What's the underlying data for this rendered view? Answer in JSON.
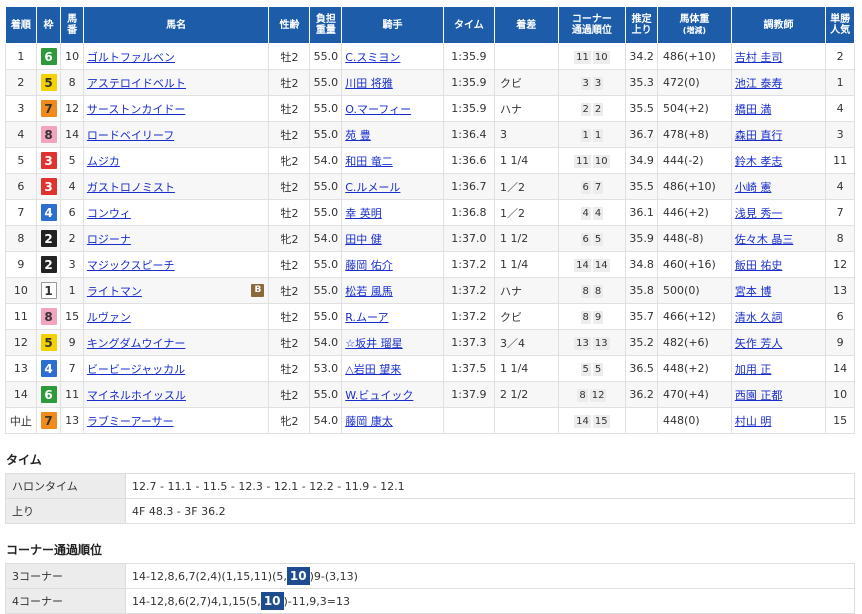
{
  "headers": {
    "rank": "着順",
    "waku": "枠",
    "umaban": [
      "馬",
      "番"
    ],
    "horse": "馬名",
    "sexage": "性齢",
    "weight": [
      "負担",
      "重量"
    ],
    "jockey": "騎手",
    "time": "タイム",
    "margin": "着差",
    "corner": [
      "コーナー",
      "通過順位"
    ],
    "last3f": [
      "推定",
      "上り"
    ],
    "hweight": [
      "馬体重",
      "(増減)"
    ],
    "trainer": "調教師",
    "pop": [
      "単勝",
      "人気"
    ]
  },
  "waku_colors": {
    "1": {
      "bg": "#ffffff",
      "fg": "#333333",
      "border": "#999999"
    },
    "2": {
      "bg": "#222222",
      "fg": "#ffffff",
      "border": "#222222"
    },
    "3": {
      "bg": "#e0332f",
      "fg": "#ffffff",
      "border": "#e0332f"
    },
    "4": {
      "bg": "#2d6fd0",
      "fg": "#ffffff",
      "border": "#2d6fd0"
    },
    "5": {
      "bg": "#f3d200",
      "fg": "#333333",
      "border": "#f3d200"
    },
    "6": {
      "bg": "#2f9a3b",
      "fg": "#ffffff",
      "border": "#2f9a3b"
    },
    "7": {
      "bg": "#f08a1c",
      "fg": "#333333",
      "border": "#f08a1c"
    },
    "8": {
      "bg": "#f2a4bd",
      "fg": "#333333",
      "border": "#f2a4bd"
    }
  },
  "rows": [
    {
      "rank": "1",
      "waku": "6",
      "umaban": "10",
      "horse": "ゴルトファルベン",
      "blink": "",
      "sexage": "牡2",
      "weight": "55.0",
      "jockey": "C.スミヨン",
      "time": "1:35.9",
      "margin": "",
      "corner": [
        "11",
        "10"
      ],
      "last3f": "34.2",
      "hweight": "486(+10)",
      "trainer": "吉村 圭司",
      "pop": "2"
    },
    {
      "rank": "2",
      "waku": "5",
      "umaban": "8",
      "horse": "アステロイドベルト",
      "blink": "",
      "sexage": "牡2",
      "weight": "55.0",
      "jockey": "川田 将雅",
      "time": "1:35.9",
      "margin": "クビ",
      "corner": [
        "3",
        "3"
      ],
      "last3f": "35.3",
      "hweight": "472(0)",
      "trainer": "池江 泰寿",
      "pop": "1"
    },
    {
      "rank": "3",
      "waku": "7",
      "umaban": "12",
      "horse": "サーストンカイドー",
      "blink": "",
      "sexage": "牡2",
      "weight": "55.0",
      "jockey": "O.マーフィー",
      "time": "1:35.9",
      "margin": "ハナ",
      "corner": [
        "2",
        "2"
      ],
      "last3f": "35.5",
      "hweight": "504(+2)",
      "trainer": "橋田 満",
      "pop": "4"
    },
    {
      "rank": "4",
      "waku": "8",
      "umaban": "14",
      "horse": "ロードベイリーフ",
      "blink": "",
      "sexage": "牡2",
      "weight": "55.0",
      "jockey": "苑 豊",
      "time": "1:36.4",
      "margin": "3",
      "corner": [
        "1",
        "1"
      ],
      "last3f": "36.7",
      "hweight": "478(+8)",
      "trainer": "森田 直行",
      "pop": "3"
    },
    {
      "rank": "5",
      "waku": "3",
      "umaban": "5",
      "horse": "ムジカ",
      "blink": "",
      "sexage": "牝2",
      "weight": "54.0",
      "jockey": "和田 竜二",
      "time": "1:36.6",
      "margin": "1 1/4",
      "corner": [
        "11",
        "10"
      ],
      "last3f": "34.9",
      "hweight": "444(-2)",
      "trainer": "鈴木 孝志",
      "pop": "11"
    },
    {
      "rank": "6",
      "waku": "3",
      "umaban": "4",
      "horse": "ガストロノミスト",
      "blink": "",
      "sexage": "牡2",
      "weight": "55.0",
      "jockey": "C.ルメール",
      "time": "1:36.7",
      "margin": "1／2",
      "corner": [
        "6",
        "7"
      ],
      "last3f": "35.5",
      "hweight": "486(+10)",
      "trainer": "小崎 憲",
      "pop": "4"
    },
    {
      "rank": "7",
      "waku": "4",
      "umaban": "6",
      "horse": "コンウィ",
      "blink": "",
      "sexage": "牡2",
      "weight": "55.0",
      "jockey": "幸 英明",
      "time": "1:36.8",
      "margin": "1／2",
      "corner": [
        "4",
        "4"
      ],
      "last3f": "36.1",
      "hweight": "446(+2)",
      "trainer": "浅見 秀一",
      "pop": "7"
    },
    {
      "rank": "8",
      "waku": "2",
      "umaban": "2",
      "horse": "ロジーナ",
      "blink": "",
      "sexage": "牝2",
      "weight": "54.0",
      "jockey": "田中 健",
      "time": "1:37.0",
      "margin": "1 1/2",
      "corner": [
        "6",
        "5"
      ],
      "last3f": "35.9",
      "hweight": "448(-8)",
      "trainer": "佐々木 晶三",
      "pop": "8"
    },
    {
      "rank": "9",
      "waku": "2",
      "umaban": "3",
      "horse": "マジックスピーチ",
      "blink": "",
      "sexage": "牡2",
      "weight": "55.0",
      "jockey": "藤岡 佑介",
      "time": "1:37.2",
      "margin": "1 1/4",
      "corner": [
        "14",
        "14"
      ],
      "last3f": "34.8",
      "hweight": "460(+16)",
      "trainer": "飯田 祐史",
      "pop": "12"
    },
    {
      "rank": "10",
      "waku": "1",
      "umaban": "1",
      "horse": "ライトマン",
      "blink": "B",
      "sexage": "牡2",
      "weight": "55.0",
      "jockey": "松若 風馬",
      "time": "1:37.2",
      "margin": "ハナ",
      "corner": [
        "8",
        "8"
      ],
      "last3f": "35.8",
      "hweight": "500(0)",
      "trainer": "宮本 博",
      "pop": "13"
    },
    {
      "rank": "11",
      "waku": "8",
      "umaban": "15",
      "horse": "ルヴァン",
      "blink": "",
      "sexage": "牡2",
      "weight": "55.0",
      "jockey": "R.ムーア",
      "time": "1:37.2",
      "margin": "クビ",
      "corner": [
        "8",
        "9"
      ],
      "last3f": "35.7",
      "hweight": "466(+12)",
      "trainer": "清水 久詞",
      "pop": "6"
    },
    {
      "rank": "12",
      "waku": "5",
      "umaban": "9",
      "horse": "キングダムウイナー",
      "blink": "",
      "sexage": "牡2",
      "weight": "54.0",
      "jockey": "☆坂井 瑠星",
      "time": "1:37.3",
      "margin": "3／4",
      "corner": [
        "13",
        "13"
      ],
      "last3f": "35.2",
      "hweight": "482(+6)",
      "trainer": "矢作 芳人",
      "pop": "9"
    },
    {
      "rank": "13",
      "waku": "4",
      "umaban": "7",
      "horse": "ビービージャッカル",
      "blink": "",
      "sexage": "牡2",
      "weight": "53.0",
      "jockey": "△岩田 望来",
      "time": "1:37.5",
      "margin": "1 1/4",
      "corner": [
        "5",
        "5"
      ],
      "last3f": "36.5",
      "hweight": "448(+2)",
      "trainer": "加用 正",
      "pop": "14"
    },
    {
      "rank": "14",
      "waku": "6",
      "umaban": "11",
      "horse": "マイネルホイッスル",
      "blink": "",
      "sexage": "牡2",
      "weight": "55.0",
      "jockey": "W.ビュイック",
      "time": "1:37.9",
      "margin": "2 1/2",
      "corner": [
        "8",
        "12"
      ],
      "last3f": "36.2",
      "hweight": "470(+4)",
      "trainer": "西園 正都",
      "pop": "10"
    },
    {
      "rank": "中止",
      "waku": "7",
      "umaban": "13",
      "horse": "ラブミーアーサー",
      "blink": "",
      "sexage": "牝2",
      "weight": "54.0",
      "jockey": "藤岡 康太",
      "time": "",
      "margin": "",
      "corner": [
        "14",
        "15"
      ],
      "last3f": "",
      "hweight": "448(0)",
      "trainer": "村山 明",
      "pop": "15"
    }
  ],
  "time_section": {
    "title": "タイム",
    "rows": [
      {
        "label": "ハロンタイム",
        "value": "12.7 - 11.1 - 11.5 - 12.3 - 12.1 - 12.2 - 11.9 - 12.1"
      },
      {
        "label": "上り",
        "value": "4F 48.3 - 3F 36.2"
      }
    ]
  },
  "corner_section": {
    "title": "コーナー通過順位",
    "rows": [
      {
        "label": "3コーナー",
        "pre": "14-12,8,6,7(2,4)(1,15,11)(5,",
        "hl": "10",
        "post": ")9-(3,13)"
      },
      {
        "label": "4コーナー",
        "pre": "14-12,8,6(2,7)4,1,15(5,",
        "hl": "10",
        "post": ")-11,9,3=13"
      }
    ]
  }
}
